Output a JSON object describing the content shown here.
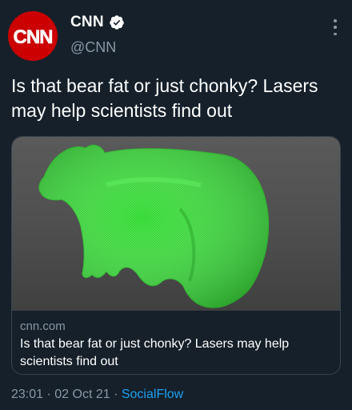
{
  "account": {
    "display_name": "CNN",
    "handle": "@CNN",
    "avatar_text": "CNN",
    "verified": true
  },
  "tweet": {
    "text": "Is that bear fat or just chonky? Lasers may help scientists find out"
  },
  "card": {
    "domain": "cnn.com",
    "title": "Is that bear fat or just chonky? Lasers may help scientists find out"
  },
  "meta": {
    "time": "23:01",
    "separator1": " · ",
    "date": "02 Oct 21",
    "separator2": " · ",
    "source": "SocialFlow"
  },
  "icons": {
    "verified": "verified-badge-icon",
    "more": "more-options-icon"
  },
  "colors": {
    "background": "#15202b",
    "secondary_text": "#8899a6",
    "link": "#1da1f2",
    "brand_red": "#cc0000",
    "bear_green": "#3ee83e"
  }
}
